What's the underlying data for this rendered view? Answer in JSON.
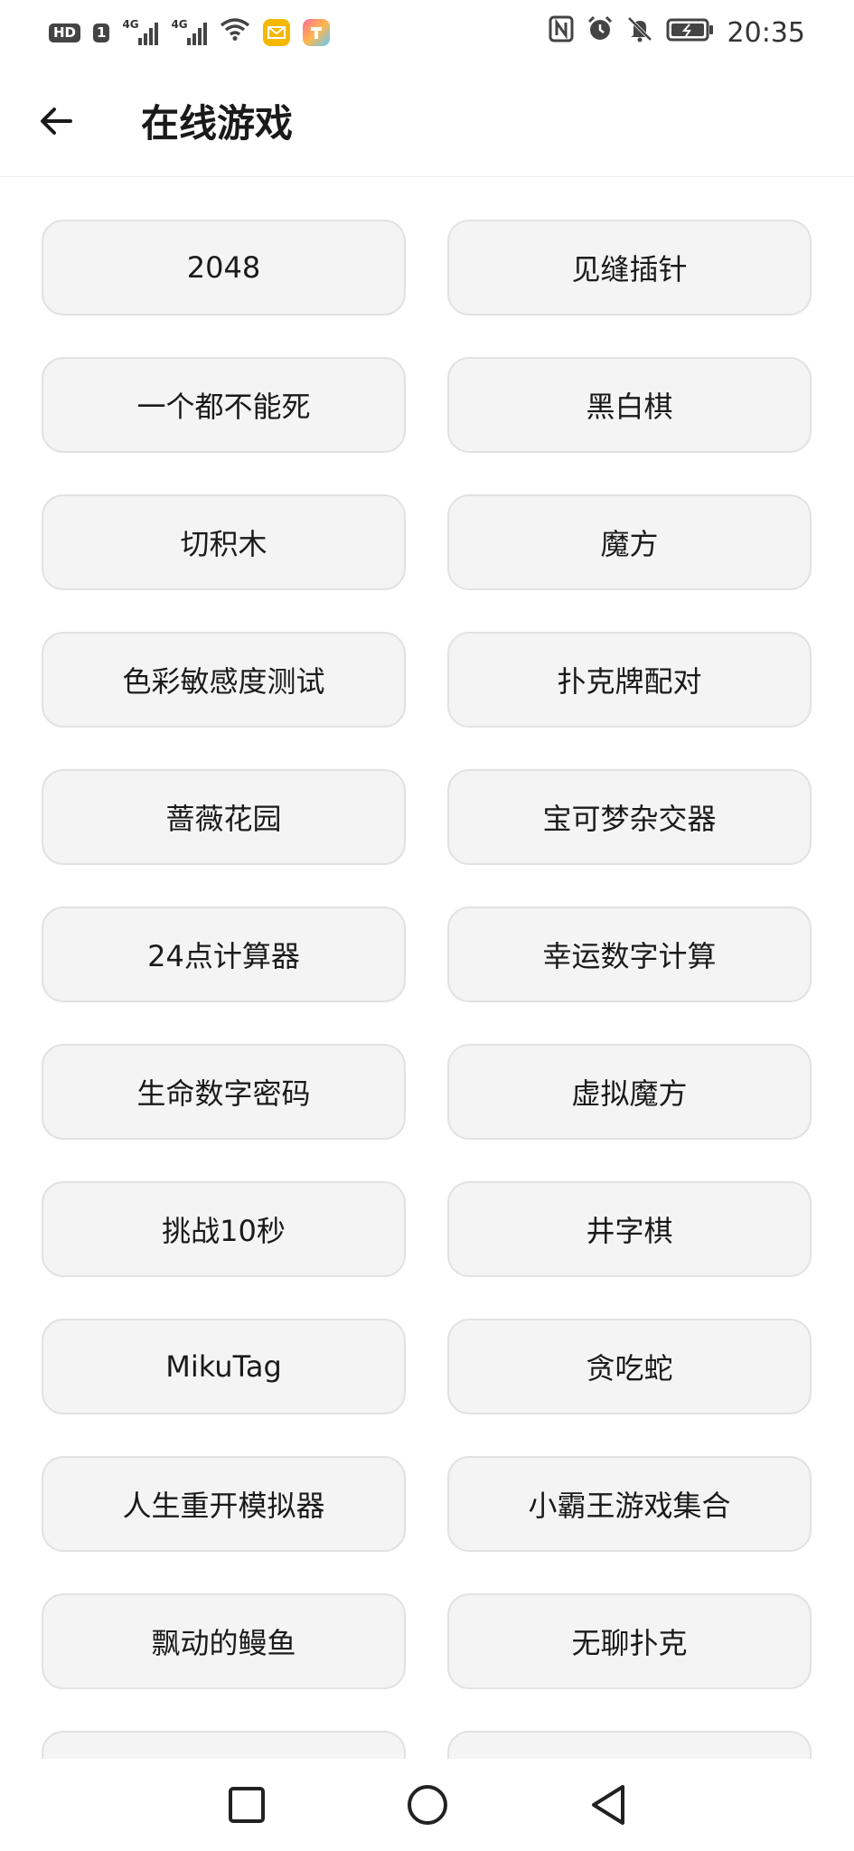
{
  "status_bar": {
    "hd_label": "HD",
    "sim_label": "1",
    "net_label_1": "4G",
    "net_label_2": "4G",
    "time": "20:35",
    "icons": [
      "hd-icon",
      "signal-icon",
      "signal-icon",
      "wifi-icon",
      "mail-app-icon",
      "app-icon",
      "nfc-icon",
      "alarm-icon",
      "mute-icon",
      "battery-icon"
    ]
  },
  "app_bar": {
    "title": "在线游戏",
    "back_icon": "arrow-left-icon"
  },
  "games": [
    {
      "label": "2048"
    },
    {
      "label": "见缝插针"
    },
    {
      "label": "一个都不能死"
    },
    {
      "label": "黑白棋"
    },
    {
      "label": "切积木"
    },
    {
      "label": "魔方"
    },
    {
      "label": "色彩敏感度测试"
    },
    {
      "label": "扑克牌配对"
    },
    {
      "label": "蔷薇花园"
    },
    {
      "label": "宝可梦杂交器"
    },
    {
      "label": "24点计算器"
    },
    {
      "label": "幸运数字计算"
    },
    {
      "label": "生命数字密码"
    },
    {
      "label": "虚拟魔方"
    },
    {
      "label": "挑战10秒"
    },
    {
      "label": "井字棋"
    },
    {
      "label": "MikuTag"
    },
    {
      "label": "贪吃蛇"
    },
    {
      "label": "人生重开模拟器"
    },
    {
      "label": "小霸王游戏集合"
    },
    {
      "label": "飘动的鳗鱼"
    },
    {
      "label": "无聊扑克"
    },
    {
      "label": ""
    },
    {
      "label": ""
    }
  ],
  "nav_bar": {
    "icons": [
      "recents-square-icon",
      "home-circle-icon",
      "back-triangle-icon"
    ]
  },
  "colors": {
    "button_bg": "#f4f4f4",
    "button_border": "#e2e2e2",
    "text": "#1a1a1a"
  }
}
